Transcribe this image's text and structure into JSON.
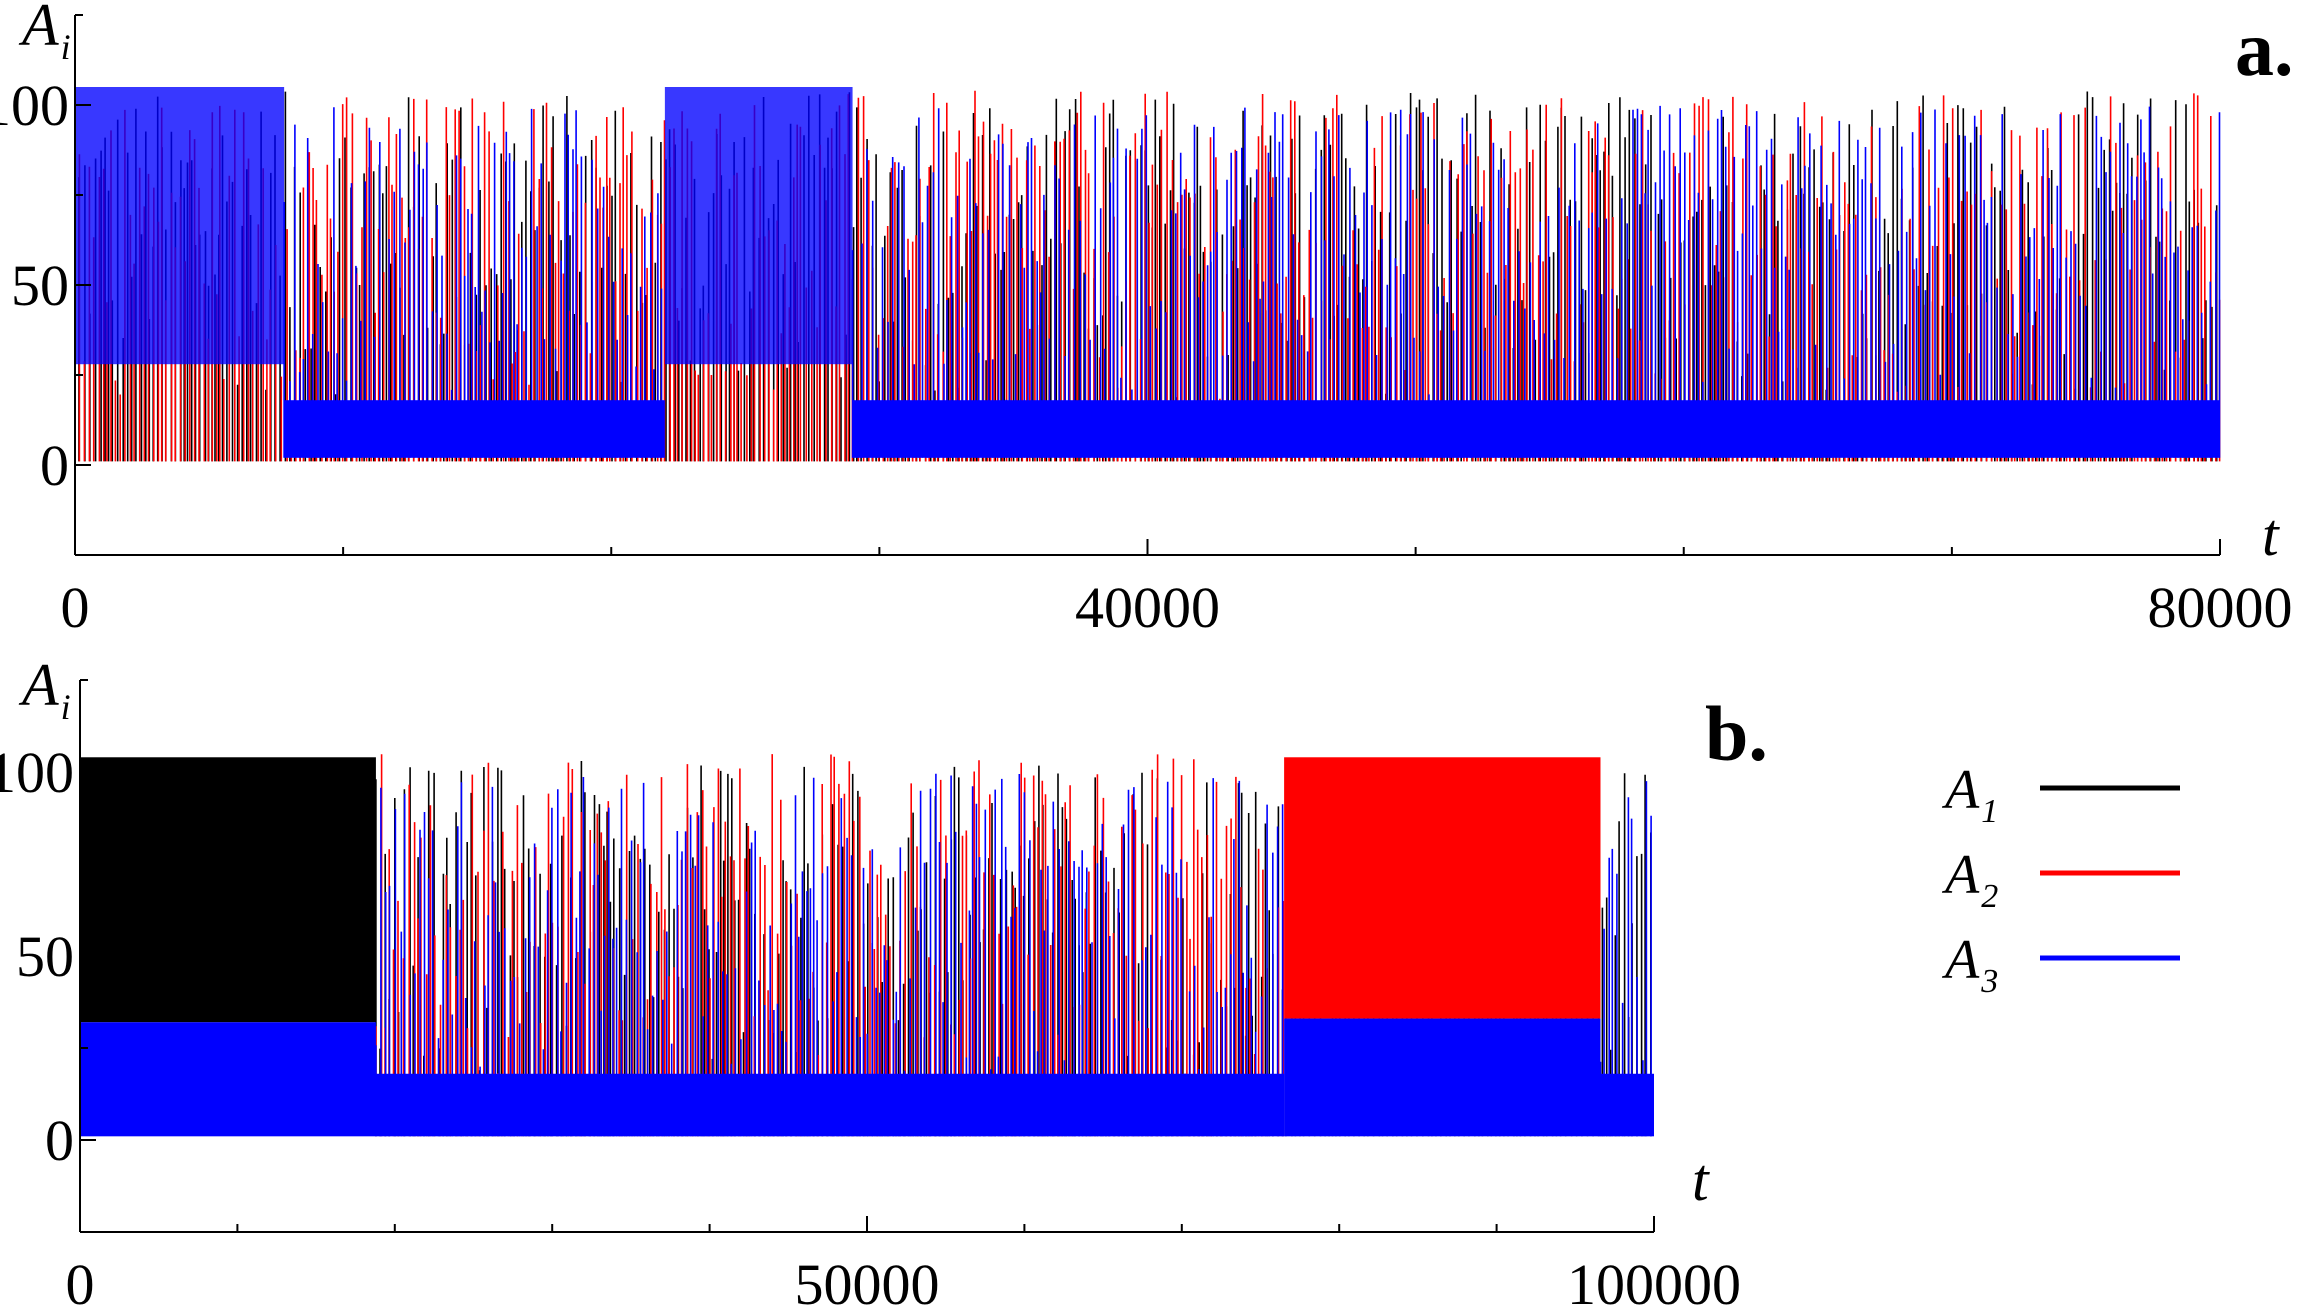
{
  "chart_data": [
    {
      "type": "line",
      "panel_label": "a.",
      "xlabel": "t",
      "ylabel_base": "A",
      "ylabel_sub": "i",
      "xlim": [
        0,
        80000
      ],
      "ylim": [
        -25,
        125
      ],
      "xticks": [
        {
          "value": 0,
          "label": "0"
        },
        {
          "value": 40000,
          "label": "40000"
        },
        {
          "value": 80000,
          "label": "80000"
        }
      ],
      "yticks": [
        {
          "value": 0,
          "label": "0"
        },
        {
          "value": 50,
          "label": "50"
        },
        {
          "value": 100,
          "label": "100"
        }
      ],
      "series": [
        {
          "name": "A1",
          "color": "#000000",
          "segments": [
            {
              "x": [
                0,
                80000
              ],
              "mode": "chaotic",
              "min": 1,
              "max": 104
            }
          ]
        },
        {
          "name": "A2",
          "color": "#ff0000",
          "segments": [
            {
              "x": [
                0,
                80000
              ],
              "mode": "chaotic",
              "min": 1,
              "max": 104
            }
          ]
        },
        {
          "name": "A3",
          "color": "#0000ff",
          "segments": [
            {
              "x": [
                0,
                7800
              ],
              "mode": "band",
              "min": 28,
              "max": 105
            },
            {
              "x": [
                7800,
                22000
              ],
              "mode": "chaotic",
              "min": 2,
              "max": 100
            },
            {
              "x": [
                22000,
                29000
              ],
              "mode": "band",
              "min": 28,
              "max": 105
            },
            {
              "x": [
                29000,
                80000
              ],
              "mode": "chaotic",
              "min": 2,
              "max": 100
            }
          ]
        }
      ]
    },
    {
      "type": "line",
      "panel_label": "b.",
      "xlabel": "t",
      "ylabel_base": "A",
      "ylabel_sub": "i",
      "xlim": [
        0,
        100000
      ],
      "ylim": [
        -25,
        125
      ],
      "xticks": [
        {
          "value": 0,
          "label": "0"
        },
        {
          "value": 50000,
          "label": "50000"
        },
        {
          "value": 100000,
          "label": "100000"
        }
      ],
      "yticks": [
        {
          "value": 0,
          "label": "0"
        },
        {
          "value": 50,
          "label": "50"
        },
        {
          "value": 100,
          "label": "100"
        }
      ],
      "series": [
        {
          "name": "A1",
          "color": "#000000",
          "segments": [
            {
              "x": [
                0,
                18800
              ],
              "mode": "band",
              "min": 32,
              "max": 104
            },
            {
              "x": [
                18800,
                100000
              ],
              "mode": "chaotic",
              "min": 1,
              "max": 103
            }
          ]
        },
        {
          "name": "A2",
          "color": "#ff0000",
          "segments": [
            {
              "x": [
                18800,
                76500
              ],
              "mode": "chaotic",
              "min": 1,
              "max": 105
            },
            {
              "x": [
                76500,
                96600
              ],
              "mode": "band",
              "min": 33,
              "max": 104
            }
          ]
        },
        {
          "name": "A3",
          "color": "#0000ff",
          "segments": [
            {
              "x": [
                0,
                18800
              ],
              "mode": "band",
              "min": 1,
              "max": 32
            },
            {
              "x": [
                18800,
                76500
              ],
              "mode": "chaotic",
              "min": 1,
              "max": 100
            },
            {
              "x": [
                76500,
                96600
              ],
              "mode": "band",
              "min": 1,
              "max": 33
            },
            {
              "x": [
                96600,
                100000
              ],
              "mode": "chaotic",
              "min": 1,
              "max": 98
            }
          ]
        }
      ]
    }
  ],
  "legend": {
    "placement": "right of panel b",
    "entries": [
      {
        "base": "A",
        "sub": "1",
        "color": "#000000"
      },
      {
        "base": "A",
        "sub": "2",
        "color": "#ff0000"
      },
      {
        "base": "A",
        "sub": "3",
        "color": "#0000ff"
      }
    ]
  }
}
